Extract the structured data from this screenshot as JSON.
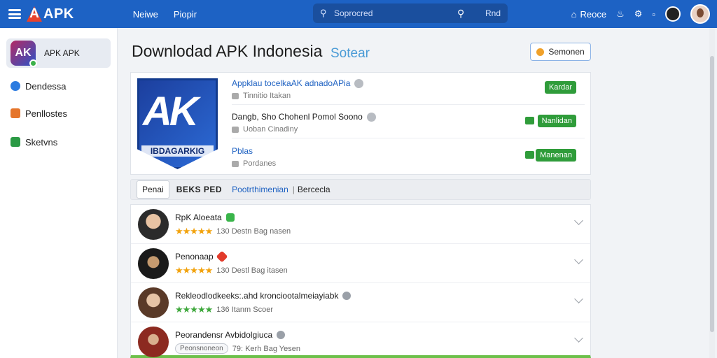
{
  "topbar": {
    "logo_text": "APK",
    "nav": [
      "Neiwe",
      "Piopir"
    ],
    "search_placeholder": "Soprocred",
    "search_hint": "Rnd",
    "right_label": "Reoce"
  },
  "sidebar": {
    "app_label": "APK APK",
    "items": [
      {
        "label": "Dendessa",
        "icon": "circle-icon"
      },
      {
        "label": "Penllostes",
        "icon": "bag-icon"
      },
      {
        "label": "Sketvns",
        "icon": "box-icon"
      }
    ]
  },
  "page": {
    "title": "Downlodad APK Indonesia",
    "subtitle": "Sotear",
    "top_button": "Semonen"
  },
  "card": {
    "icon_letters": "AK",
    "icon_band": "IBDAGARKIG",
    "rows": [
      {
        "title": "Appklau tocelkaAK adnadoAPia",
        "sub": "Tinnitio Itakan",
        "button": "Kardar"
      },
      {
        "title": "Dangb, Sho Chohenl Pomol Soono",
        "sub": "Uoban Cinadiny",
        "button": "Nanlidan"
      },
      {
        "title": "Pblas",
        "sub": "Pordanes",
        "button": "Manenan"
      }
    ]
  },
  "tabs": {
    "first": "Penai",
    "second": "BEKS PED",
    "third": "Pootrthimenian",
    "fourth": "Bercecla"
  },
  "list": [
    {
      "name": "RpK Aloeata",
      "meta": "130 Destn Bag nasen",
      "stars": "★★★★★"
    },
    {
      "name": "Penonaap",
      "meta": "130 Destl Bag itasen",
      "stars": "★★★★★"
    },
    {
      "name": "Rekleodlodkeeks:.ahd kronciootalmeiayiabk",
      "meta": "136 Itanm Scoer",
      "stars": "★★★★★"
    },
    {
      "name": "Peorandensr Avbidolgiuca",
      "meta": "79: Kerh Bag Yesen",
      "pill": "Peonsnoneon"
    }
  ],
  "colors": {
    "topbar": "#1d62c4",
    "accent_green": "#2f9c3a",
    "logo_red": "#e8412c"
  }
}
